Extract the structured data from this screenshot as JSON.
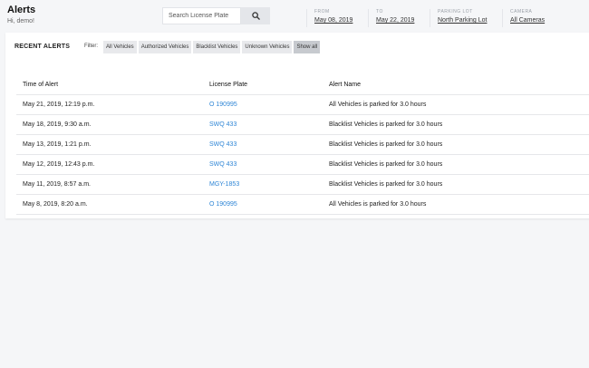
{
  "header": {
    "title": "Alerts",
    "greeting": "Hi, demo!"
  },
  "search": {
    "placeholder": "Search License Plate"
  },
  "filters": {
    "from": {
      "label": "FROM",
      "value": "May 08, 2019"
    },
    "to": {
      "label": "TO",
      "value": "May 22, 2019"
    },
    "parking_lot": {
      "label": "PARKING LOT",
      "value": "North Parking Lot"
    },
    "camera": {
      "label": "CAMERA",
      "value": "All Cameras"
    }
  },
  "alerts_card": {
    "title": "RECENT ALERTS",
    "filter_prefix": "Filter:",
    "chips": [
      "All Vehicles",
      "Authorized Vehicles",
      "Blacklist Vehicles",
      "Unknown Vehicles",
      "Show all"
    ],
    "active_chip": "Show all"
  },
  "table": {
    "columns": [
      "Time of Alert",
      "License Plate",
      "Alert Name"
    ],
    "rows": [
      {
        "time": "May 21, 2019, 12:19 p.m.",
        "plate": "O 190995",
        "alert": "All Vehicles is parked for 3.0 hours"
      },
      {
        "time": "May 18, 2019, 9:30 a.m.",
        "plate": "SWQ 433",
        "alert": "Blacklist Vehicles is parked for 3.0 hours"
      },
      {
        "time": "May 13, 2019, 1:21 p.m.",
        "plate": "SWQ 433",
        "alert": "Blacklist Vehicles is parked for 3.0 hours"
      },
      {
        "time": "May 12, 2019, 12:43 p.m.",
        "plate": "SWQ 433",
        "alert": "Blacklist Vehicles is parked for 3.0 hours"
      },
      {
        "time": "May 11, 2019, 8:57 a.m.",
        "plate": "MGY-1853",
        "alert": "Blacklist Vehicles is parked for 3.0 hours"
      },
      {
        "time": "May 8, 2019, 8:20 a.m.",
        "plate": "O 190995",
        "alert": "All Vehicles is parked for 3.0 hours"
      }
    ]
  },
  "colors": {
    "link": "#2f86d6",
    "background": "#f5f6f8",
    "chip": "#e8e9ec",
    "chip_active": "#c7cacf"
  },
  "icons": {
    "search": "search-icon"
  }
}
